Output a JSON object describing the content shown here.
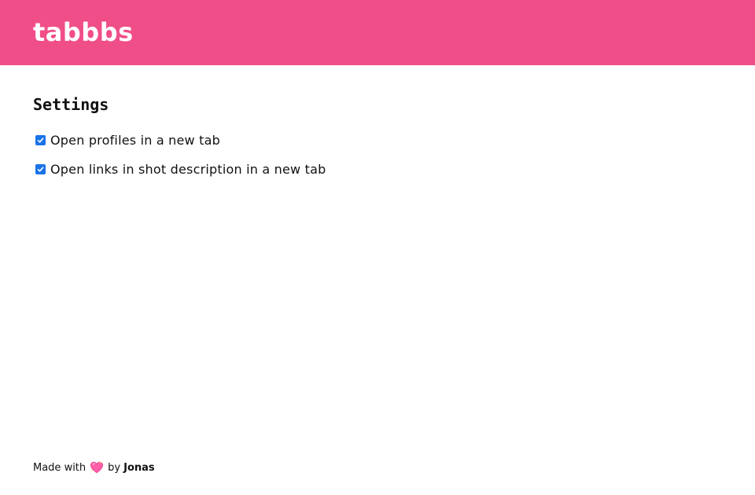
{
  "app": {
    "title": "tabbbs",
    "brand_color": "#f04e88"
  },
  "settings": {
    "title": "Settings",
    "options": [
      {
        "label": "Open profiles in a new tab",
        "checked": true
      },
      {
        "label": "Open links in shot description in a new tab",
        "checked": true
      }
    ]
  },
  "footer": {
    "made_with": "Made with",
    "heart_icon": "sparkling-heart-icon",
    "by": "by",
    "author": "Jonas"
  }
}
